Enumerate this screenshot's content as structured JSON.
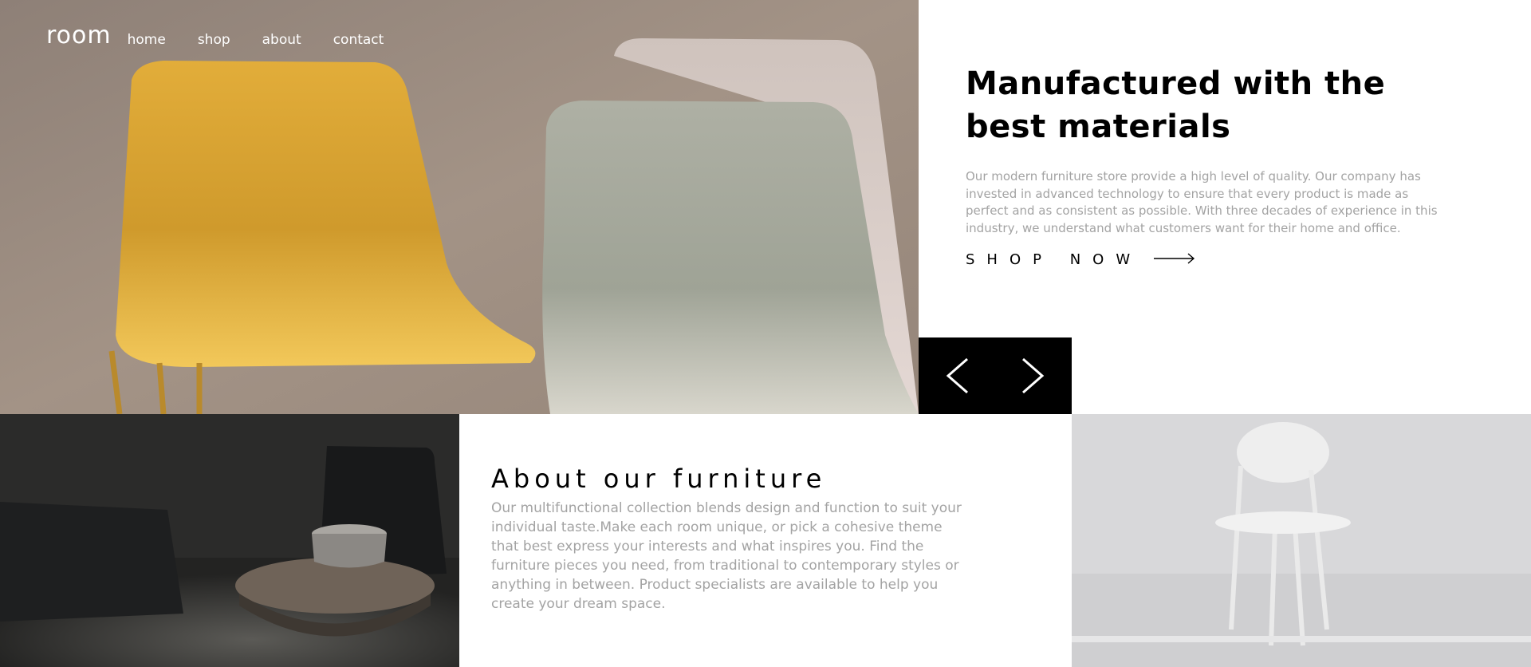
{
  "nav": {
    "logo": "room",
    "links": [
      "home",
      "shop",
      "about",
      "contact"
    ]
  },
  "hero": {
    "title": "Manufactured with the best materials",
    "description": "Our modern furniture store provide a high level of quality. Our company has invested in advanced technology to ensure that every product is made as perfect and as consistent as possible. With three decades of experience in this industry, we understand what customers want for their home and office.",
    "cta_label": "SHOP NOW",
    "cta_icon": "arrow-right-icon",
    "slider_icons": [
      "chevron-left-icon",
      "chevron-right-icon"
    ]
  },
  "about": {
    "title": "About our furniture",
    "description": "Our multifunctional collection blends design and function to suit your individual taste.Make each room unique, or pick a cohesive theme that best express your interests and what inspires you. Find the furniture pieces you need, from traditional to contemporary styles or anything in between. Product specialists are available to help you create your dream space."
  },
  "colors": {
    "text_primary": "#000000",
    "text_muted": "#a3a3a3",
    "background": "#ffffff",
    "controls_bg": "#000000"
  }
}
